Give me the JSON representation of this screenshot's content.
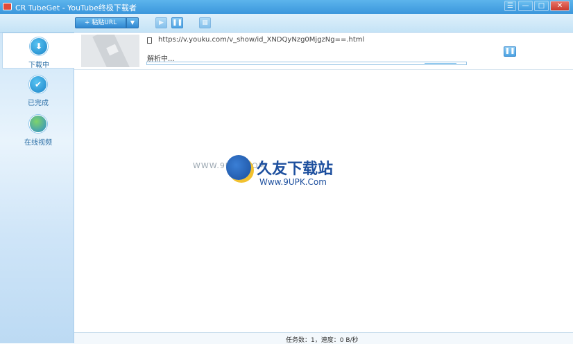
{
  "window": {
    "title": "CR TubeGet - YouTube终极下载者"
  },
  "window_controls": {
    "menu": "☰",
    "minimize": "—",
    "maximize": "□",
    "close": "✕"
  },
  "toolbar": {
    "paste_url_label": "+ 粘贴URL",
    "dropdown_glyph": "▼",
    "start_glyph": "▶",
    "pause_glyph": "❚❚",
    "delete_glyph": "▦"
  },
  "sidebar": {
    "items": [
      {
        "label": "下载中",
        "icon": "download-icon",
        "glyph": "⬇",
        "active": true
      },
      {
        "label": "已完成",
        "icon": "check-icon",
        "glyph": "✔",
        "active": false
      },
      {
        "label": "在线视频",
        "icon": "globe-icon",
        "glyph": "",
        "active": false
      }
    ]
  },
  "task": {
    "url": "https://v.youku.com/v_show/id_XNDQyNzg0MjgzNg==.html",
    "status": "解析中...",
    "pause_glyph": "❚❚"
  },
  "watermark": {
    "left_text": "WWW.9UPK.COM",
    "cn_text": "久友下载站",
    "en_text": "Www.9UPK.Com"
  },
  "statusbar": {
    "text": "任务数：1，速度：0 B/秒"
  },
  "colors": {
    "accent": "#3b97dc",
    "sidebar_bg": "#d7eaf9"
  }
}
